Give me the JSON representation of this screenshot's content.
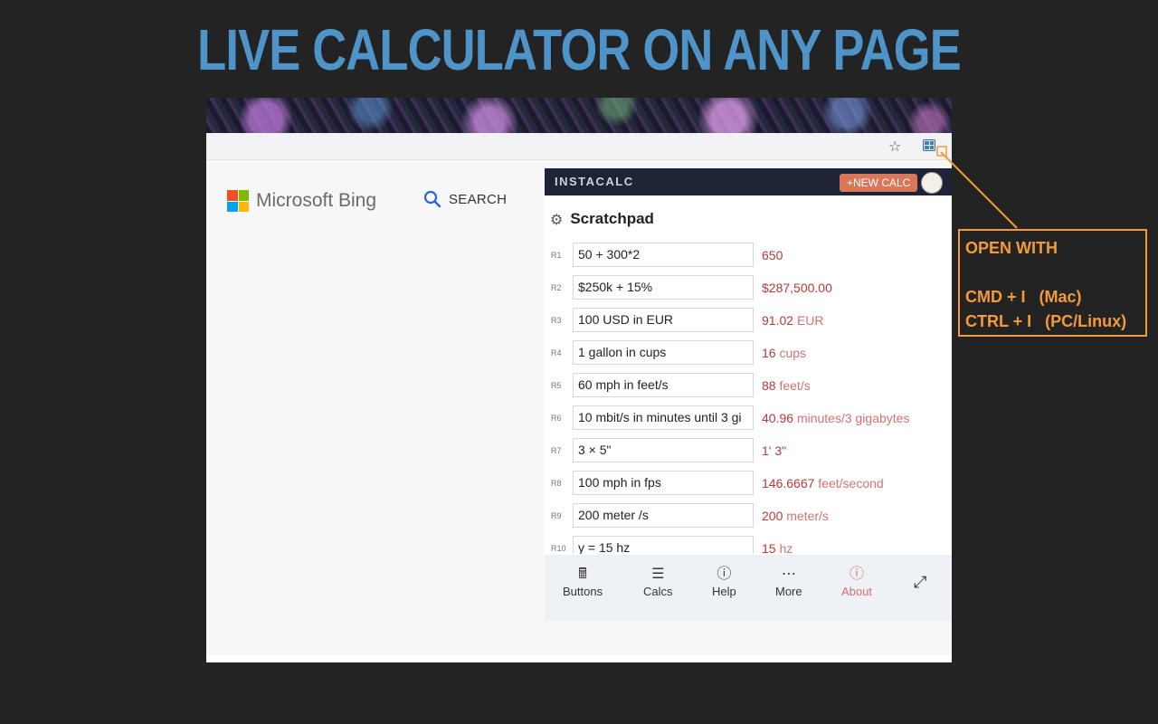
{
  "headline": "LIVE CALCULATOR ON ANY PAGE",
  "colors": {
    "background": "#232323",
    "headline": "#4f94c9",
    "accent_orange": "#f39a3a",
    "result_number": "#b53a3a",
    "result_unit": "#d77272",
    "header_bg": "#1e2335"
  },
  "browser": {
    "star_icon": "star-icon",
    "extension_icon": "instacalc-extension-icon"
  },
  "page": {
    "bing_label": "Microsoft Bing",
    "search_label": "SEARCH"
  },
  "popup": {
    "brand": "INSTACALC",
    "new_calc": "+NEW CALC",
    "scratchpad_title": "Scratchpad",
    "rows": [
      {
        "label": "R1",
        "input": "50 + 300*2",
        "value": "650",
        "unit": ""
      },
      {
        "label": "R2",
        "input": "$250k + 15%",
        "value": "$287,500.00",
        "unit": ""
      },
      {
        "label": "R3",
        "input": "100 USD in EUR",
        "value": "91.02",
        "unit": "EUR"
      },
      {
        "label": "R4",
        "input": "1 gallon in cups",
        "value": "16",
        "unit": "cups"
      },
      {
        "label": "R5",
        "input": "60 mph in feet/s",
        "value": "88",
        "unit": "feet/s"
      },
      {
        "label": "R6",
        "input": "10 mbit/s in minutes until 3 gi",
        "value": "40.96",
        "unit": "minutes/3 gigabytes"
      },
      {
        "label": "R7",
        "input": "3 × 5\"",
        "value": "1' 3\"",
        "unit": ""
      },
      {
        "label": "R8",
        "input": "100 mph in fps",
        "value": "146.6667",
        "unit": "feet/second"
      },
      {
        "label": "R9",
        "input": "200 meter /s",
        "value": "200",
        "unit": "meter/s"
      },
      {
        "label": "R10",
        "input": "y = 15 hz",
        "value": "15",
        "unit": "hz"
      }
    ],
    "nav": {
      "buttons": "Buttons",
      "calcs": "Calcs",
      "help": "Help",
      "more": "More",
      "about": "About"
    }
  },
  "callout": {
    "title": "OPEN WITH",
    "mac": "CMD + I   (Mac)",
    "pc": "CTRL + I   (PC/Linux)"
  }
}
